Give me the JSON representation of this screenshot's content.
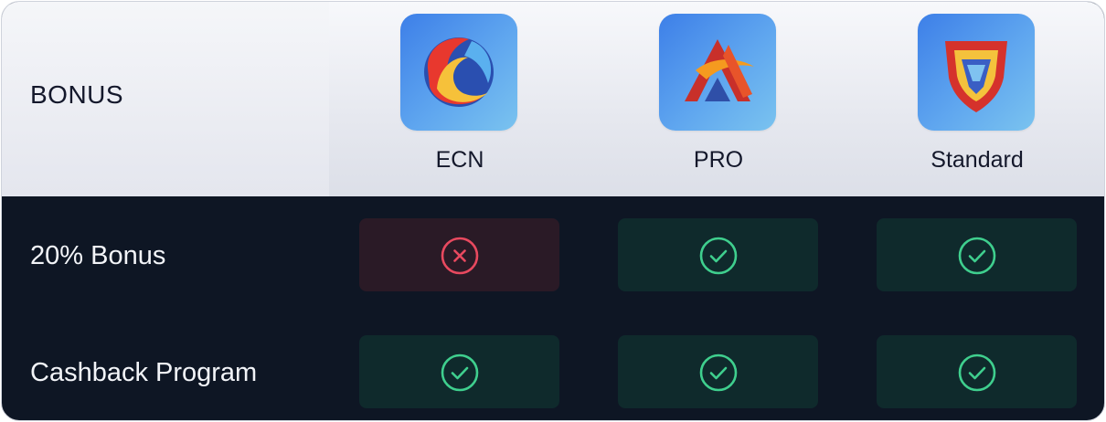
{
  "header": {
    "title": "BONUS"
  },
  "plans": [
    {
      "name": "ECN",
      "icon": "ecn-logo-icon"
    },
    {
      "name": "PRO",
      "icon": "pro-logo-icon"
    },
    {
      "name": "Standard",
      "icon": "standard-logo-icon"
    }
  ],
  "rows": [
    {
      "label": "20% Bonus",
      "values": [
        "no",
        "yes",
        "yes"
      ]
    },
    {
      "label": "Cashback Program",
      "values": [
        "yes",
        "yes",
        "yes"
      ]
    }
  ],
  "colors": {
    "yes": "#3fcf8e",
    "no": "#e8495f",
    "header_bg": "#eceef3",
    "body_bg": "#0e1624"
  }
}
